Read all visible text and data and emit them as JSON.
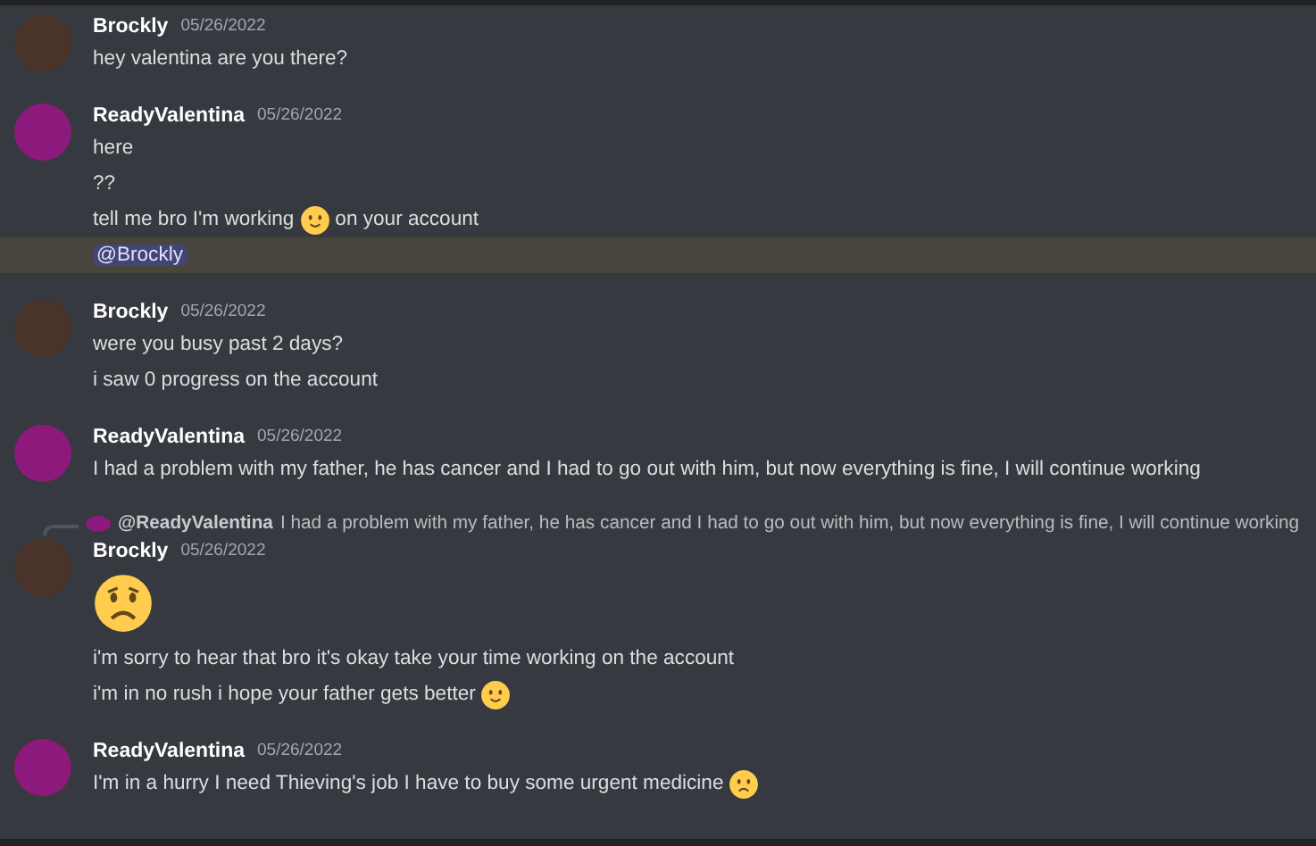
{
  "messages": [
    {
      "author": "Brockly",
      "avatar": {
        "color": "#4a3328"
      },
      "timestamp": "05/26/2022",
      "lines": [
        {
          "mentioned": false,
          "parts": [
            {
              "kind": "text",
              "text": "hey valentina are you there?"
            }
          ]
        }
      ]
    },
    {
      "author": "ReadyValentina",
      "avatar": {
        "color": "#8c1a7c"
      },
      "timestamp": "05/26/2022",
      "lines": [
        {
          "mentioned": false,
          "parts": [
            {
              "kind": "text",
              "text": "here"
            }
          ]
        },
        {
          "mentioned": false,
          "parts": [
            {
              "kind": "text",
              "text": "??"
            }
          ]
        },
        {
          "mentioned": false,
          "parts": [
            {
              "kind": "text",
              "text": "tell me bro I'm working"
            },
            {
              "kind": "smile"
            },
            {
              "kind": "text",
              "text": "on your account"
            }
          ]
        },
        {
          "mentioned": true,
          "parts": [
            {
              "kind": "mention",
              "text": "@Brockly"
            }
          ]
        }
      ]
    },
    {
      "author": "Brockly",
      "avatar": {
        "color": "#4a3328"
      },
      "timestamp": "05/26/2022",
      "lines": [
        {
          "mentioned": false,
          "parts": [
            {
              "kind": "text",
              "text": "were you busy past 2 days?"
            }
          ]
        },
        {
          "mentioned": false,
          "parts": [
            {
              "kind": "text",
              "text": "i saw 0 progress on the account"
            }
          ]
        }
      ]
    },
    {
      "author": "ReadyValentina",
      "avatar": {
        "color": "#8c1a7c"
      },
      "timestamp": "05/26/2022",
      "lines": [
        {
          "mentioned": false,
          "parts": [
            {
              "kind": "text",
              "text": "I had a problem with my father, he has cancer and I had to go out with him, but now everything is fine, I will continue working"
            }
          ]
        }
      ]
    },
    {
      "author": "Brockly",
      "avatar": {
        "color": "#4a3328"
      },
      "timestamp": "05/26/2022",
      "reply": {
        "author": "@ReadyValentina",
        "avatar": {
          "color": "#8c1a7c"
        },
        "text": "I had a problem with my father, he has cancer and I had to go out with him, but now everything is fine, I will continue working"
      },
      "lines": [
        {
          "mentioned": false,
          "parts": [
            {
              "kind": "worried"
            }
          ]
        },
        {
          "mentioned": false,
          "parts": [
            {
              "kind": "text",
              "text": "i'm sorry to hear that bro it's okay take your time working on the account"
            }
          ]
        },
        {
          "mentioned": false,
          "parts": [
            {
              "kind": "text",
              "text": "i'm in no rush i hope your father gets better"
            },
            {
              "kind": "smile"
            }
          ]
        }
      ]
    },
    {
      "author": "ReadyValentina",
      "avatar": {
        "color": "#8c1a7c"
      },
      "timestamp": "05/26/2022",
      "lines": [
        {
          "mentioned": false,
          "parts": [
            {
              "kind": "text",
              "text": "I'm in a hurry I need Thieving's job I have to buy some urgent medicine"
            },
            {
              "kind": "frown"
            }
          ]
        }
      ]
    }
  ]
}
